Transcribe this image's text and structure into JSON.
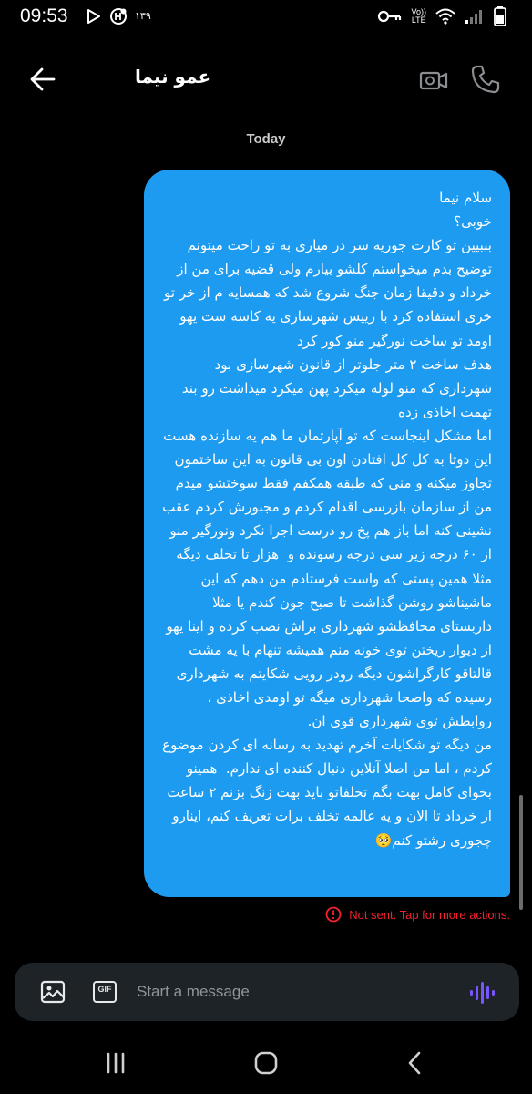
{
  "status_bar": {
    "time": "09:53",
    "left_icons": [
      "play-icon",
      "notification-icon",
      "calendar-badge-icon"
    ],
    "persian_badge_top": "۱۳",
    "persian_badge_bottom": "۹",
    "network_label_top": "Vo))",
    "network_label_bottom": "LTE",
    "right_icons": [
      "key-icon",
      "volte-icon",
      "wifi-icon",
      "signal-icon",
      "battery-icon"
    ]
  },
  "header": {
    "contact_name": "عمو نیما",
    "icons": [
      "back-arrow-icon",
      "video-call-icon",
      "phone-icon"
    ]
  },
  "conversation": {
    "day_label": "Today",
    "message_text": "سلام نیما\nخوبی؟\nبببیین تو کارت جوریه سر در میاری به تو راحت میتونم توضیح بدم میخواستم کلشو بیارم ولی قضیه برای من از خرداد و دقیقا زمان جنگ شروع شد که همسایه م از خر تو خری استفاده کرد با رییس شهرسازی یه کاسه ست یهو اومد تو ساخت نورگیر منو کور کرد\nهدف ساخت ۲ متر جلوتر از قانون شهرسازی بود شهرداری که منو لوله میکرد پهن میکرد میذاشت رو بند تهمت اخاذی زده\nاما مشکل اینجاست که تو آپارتمان ما هم یه سازنده هست این دوتا به کل کل افتادن اون بی قانون به این ساختمون تجاوز میکنه و منی که طبقه همکفم فقط سوختشو میدم من از سازمان بازرسی اقدام کردم و مجبورش کردم عقب نشینی کنه اما باز هم پخ رو درست اجرا نکرد ونورگیر منو از ۶۰ درجه زیر سی درجه رسونده و  هزار تا تخلف دیگه مثلا همین پستی که واست فرستادم من دهم که این ماشیناشو روشن گذاشت تا صبح جون کندم یا مثلا داربستای محافظشو شهرداری براش نصب کرده و اینا یهو از دیوار ریختن توی خونه منم همیشه تنهام با یه مشت قالتاقو کارگراشون دیگه رودر رویی شکایتم به شهرداری رسیده که واضحا شهرداری میگه تو اومدی اخاذی ، روابطش توی شهرداری قوی ان.\nمن دیگه تو شکایات آخرم تهدید به رسانه ای کردن موضوع کردم ، اما من اصلا آنلاین دنبال کننده ای ندارم.  همینو بخوای کامل بهت بگم تخلفاتو باید بهت زنگ بزنم ۲ ساعت از خرداد تا الان و یه عالمه تخلف برات تعریف کنم، اینارو چجوری رشتو کنم🥺",
    "status_text": "Not sent. Tap for more actions.",
    "bubble_color": "#1d9bf0",
    "error_color": "#f4212e"
  },
  "composer": {
    "placeholder": "Start a message",
    "gif_label": "GIF",
    "icons": [
      "image-icon",
      "gif-icon",
      "voice-wave-icon"
    ],
    "voice_color": "#7856ff"
  },
  "nav_bar": {
    "icons": [
      "recent-apps-icon",
      "home-icon",
      "back-icon"
    ]
  }
}
